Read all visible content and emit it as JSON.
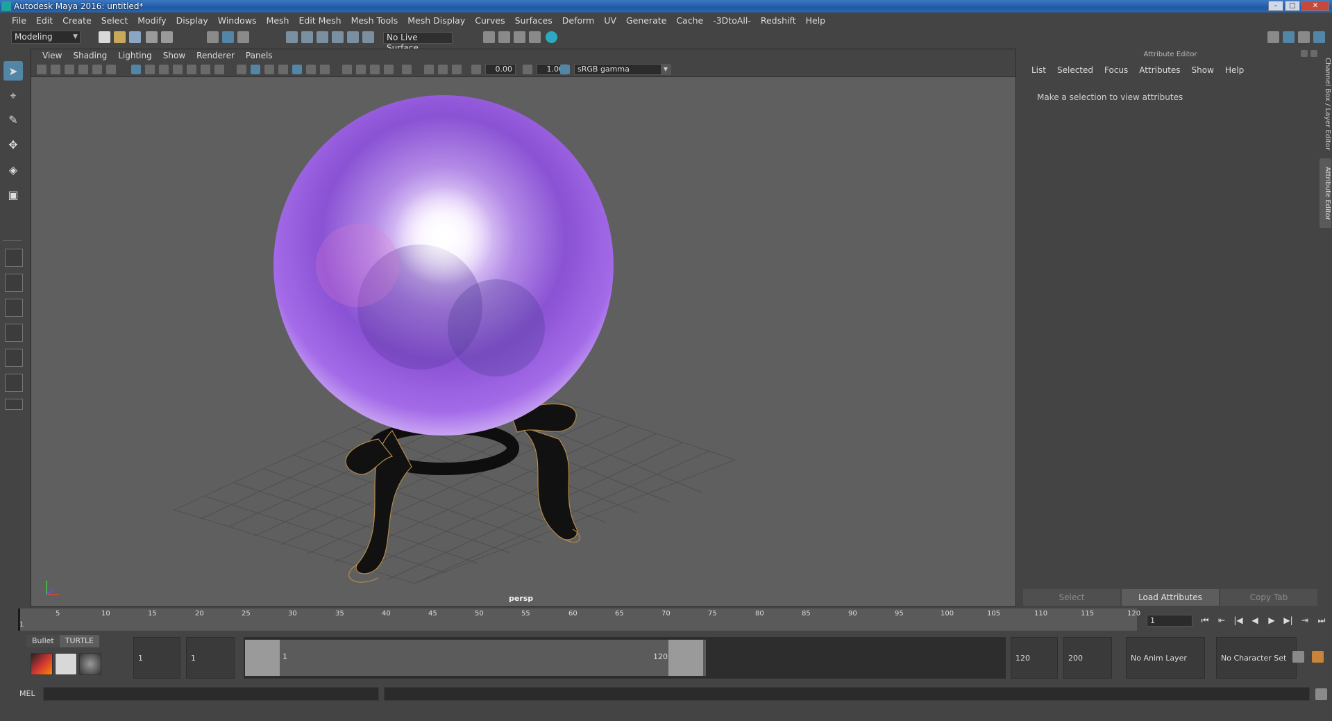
{
  "window": {
    "title": "Autodesk Maya 2016: untitled*",
    "controls": [
      "minimize",
      "maximize",
      "close"
    ]
  },
  "menubar": [
    "File",
    "Edit",
    "Create",
    "Select",
    "Modify",
    "Display",
    "Windows",
    "Mesh",
    "Edit Mesh",
    "Mesh Tools",
    "Mesh Display",
    "Curves",
    "Surfaces",
    "Deform",
    "UV",
    "Generate",
    "Cache",
    "-3DtoAll-",
    "Redshift",
    "Help"
  ],
  "statusline": {
    "mode": "Modeling",
    "live_surface": "No Live Surface"
  },
  "viewport": {
    "menu": [
      "View",
      "Shading",
      "Lighting",
      "Show",
      "Renderer",
      "Panels"
    ],
    "exposure": "0.00",
    "gamma": "1.00",
    "color_space": "sRGB gamma",
    "camera_label": "persp"
  },
  "attribute_editor": {
    "title": "Attribute Editor",
    "menu": [
      "List",
      "Selected",
      "Focus",
      "Attributes",
      "Show",
      "Help"
    ],
    "message": "Make a selection to view attributes",
    "buttons": {
      "select": "Select",
      "load": "Load Attributes",
      "copy": "Copy Tab"
    },
    "side_tabs": {
      "channel_box": "Channel Box / Layer Editor",
      "attribute_editor": "Attribute Editor"
    }
  },
  "timeslider": {
    "ticks": [
      "1",
      "5",
      "10",
      "15",
      "20",
      "25",
      "30",
      "35",
      "40",
      "45",
      "50",
      "55",
      "60",
      "65",
      "70",
      "75",
      "80",
      "85",
      "90",
      "95",
      "100",
      "105",
      "110",
      "115",
      "120"
    ],
    "current_frame": "1"
  },
  "shelf": {
    "tabs": [
      "Bullet",
      "TURTLE"
    ],
    "active_tab": "TURTLE"
  },
  "range": {
    "start_time": "1",
    "playback_start": "1",
    "range_start_label": "1",
    "range_end_label": "120",
    "playback_end": "120",
    "end_time": "200",
    "anim_layer": "No Anim Layer",
    "character_set": "No Character Set"
  },
  "cmdline": {
    "label": "MEL"
  }
}
